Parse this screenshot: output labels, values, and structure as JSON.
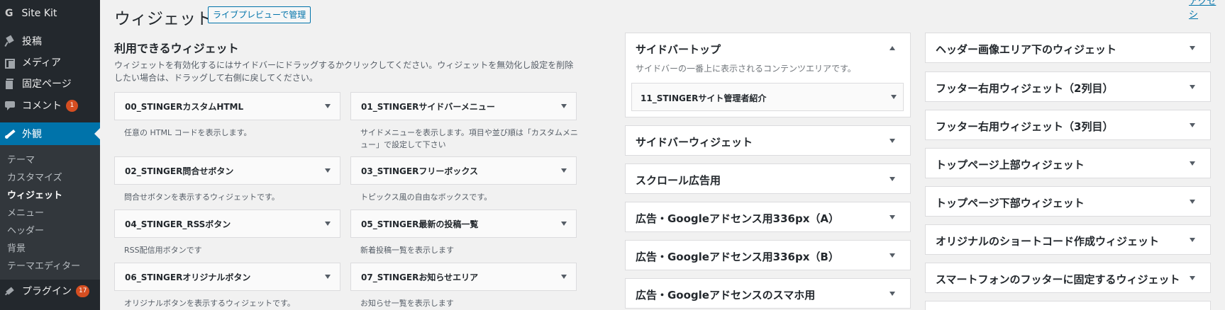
{
  "sidebar": {
    "sitekit": {
      "logo": "G",
      "label": "Site Kit"
    },
    "posts": "投稿",
    "media": "メディア",
    "pages": "固定ページ",
    "comments": {
      "label": "コメント",
      "count": "1"
    },
    "appearance": "外観",
    "submenu": [
      "テーマ",
      "カスタマイズ",
      "ウィジェット",
      "メニュー",
      "ヘッダー",
      "背景",
      "テーマエディター"
    ],
    "plugins": {
      "label": "プラグイン",
      "count": "17"
    }
  },
  "header": {
    "title": "ウィジェット",
    "action": "ライブプレビューで管理",
    "corner_link": "アクセシ"
  },
  "available": {
    "heading": "利用できるウィジェット",
    "description": "ウィジェットを有効化するにはサイドバーにドラッグするかクリックしてください。ウィジェットを無効化し設定を削除したい場合は、ドラッグして右側に戻してください。",
    "widgets": [
      {
        "title": "00_STINGERカスタムHTML",
        "desc": "任意の HTML コードを表示します。"
      },
      {
        "title": "01_STINGERサイドバーメニュー",
        "desc": "サイドメニューを表示します。項目や並び順は「カスタムメニュー」で設定して下さい"
      },
      {
        "title": "02_STINGER問合せボタン",
        "desc": "問合せボタンを表示するウィジェットです。"
      },
      {
        "title": "03_STINGERフリーボックス",
        "desc": "トピックス風の自由なボックスです。"
      },
      {
        "title": "04_STINGER_RSSボタン",
        "desc": "RSS配信用ボタンです"
      },
      {
        "title": "05_STINGER最新の投稿一覧",
        "desc": "新着投稿一覧を表示します"
      },
      {
        "title": "06_STINGERオリジナルボタン",
        "desc": "オリジナルボタンを表示するウィジェットです。"
      },
      {
        "title": "07_STINGERお知らせエリア",
        "desc": "お知らせ一覧を表示します"
      }
    ]
  },
  "areas_col1": [
    {
      "title": "サイドバートップ",
      "desc": "サイドバーの一番上に表示されるコンテンツエリアです。",
      "inner_widget": "11_STINGERサイト管理者紹介"
    },
    {
      "title": "サイドバーウィジェット"
    },
    {
      "title": "スクロール広告用"
    },
    {
      "title": "広告・Googleアドセンス用336px（A）"
    },
    {
      "title": "広告・Googleアドセンス用336px（B）"
    },
    {
      "title": "広告・Googleアドセンスのスマホ用"
    }
  ],
  "areas_col2": [
    {
      "title": "ヘッダー画像エリア下のウィジェット"
    },
    {
      "title": "フッター右用ウィジェット（2列目）"
    },
    {
      "title": "フッター右用ウィジェット（3列目）"
    },
    {
      "title": "トップページ上部ウィジェット"
    },
    {
      "title": "トップページ下部ウィジェット"
    },
    {
      "title": "オリジナルのショートコード作成ウィジェット"
    },
    {
      "title": "スマートフォンのフッターに固定するウィジェット"
    },
    {
      "title": ""
    }
  ],
  "colors": {
    "sidebar": "#23282d",
    "accent": "#0073aa",
    "badge": "#d54e21"
  }
}
